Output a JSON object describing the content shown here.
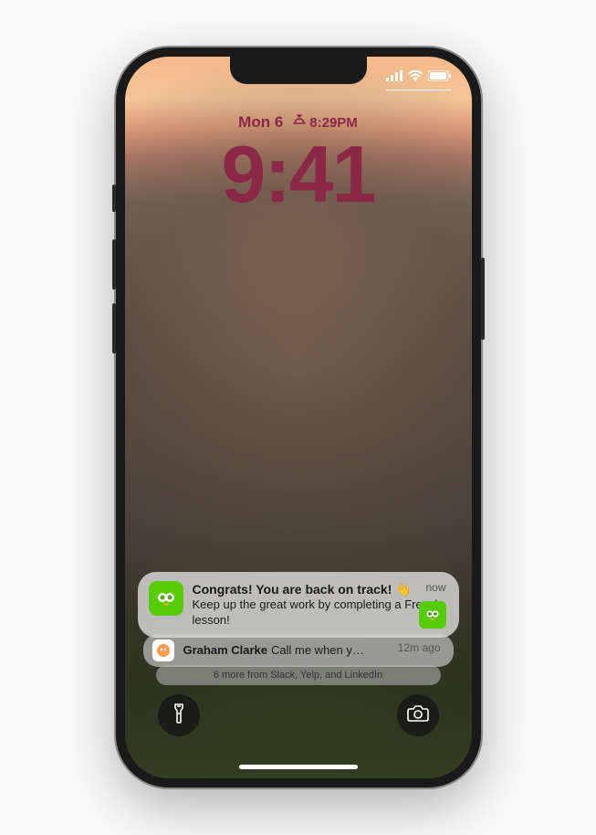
{
  "lockscreen": {
    "date": "Mon 6",
    "sunset_widget_time": "8:29PM",
    "time": "9:41"
  },
  "notifications": {
    "primary": {
      "title": "Congrats! You are back on track! 👋",
      "body": "Keep up the great work by completing a French lesson!",
      "time_label": "now"
    },
    "secondary": {
      "sender": "Graham Clarke",
      "preview": "Call me when y…",
      "time_label": "12m ago"
    },
    "summary": "6 more from Slack, Yelp, and LinkedIn"
  }
}
